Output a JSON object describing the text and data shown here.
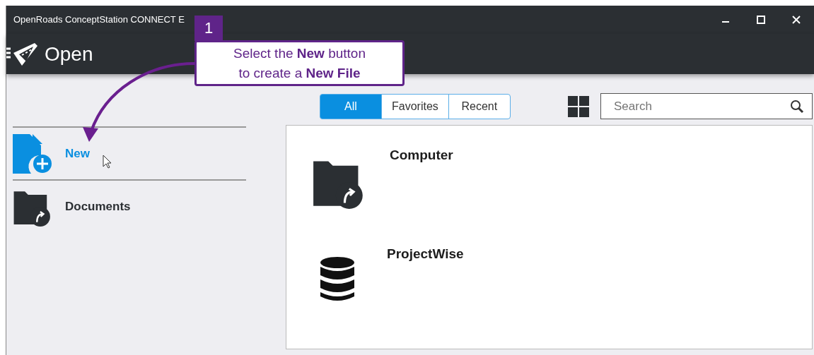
{
  "window": {
    "title": "OpenRoads ConceptStation CONNECT E"
  },
  "header": {
    "title": "Open"
  },
  "callout": {
    "step": "1",
    "lines": [
      "Select the **New** button",
      "to create a **New File**"
    ]
  },
  "sidebar": {
    "items": [
      {
        "label": "New",
        "kind": "new",
        "selected": true
      },
      {
        "label": "Documents",
        "kind": "folder",
        "selected": false
      }
    ]
  },
  "filter_tabs": [
    {
      "label": "All",
      "selected": true
    },
    {
      "label": "Favorites",
      "selected": false
    },
    {
      "label": "Recent",
      "selected": false
    }
  ],
  "search": {
    "placeholder": "Search"
  },
  "locations": [
    {
      "label": "Computer",
      "kind": "folder"
    },
    {
      "label": "ProjectWise",
      "kind": "database"
    }
  ]
}
